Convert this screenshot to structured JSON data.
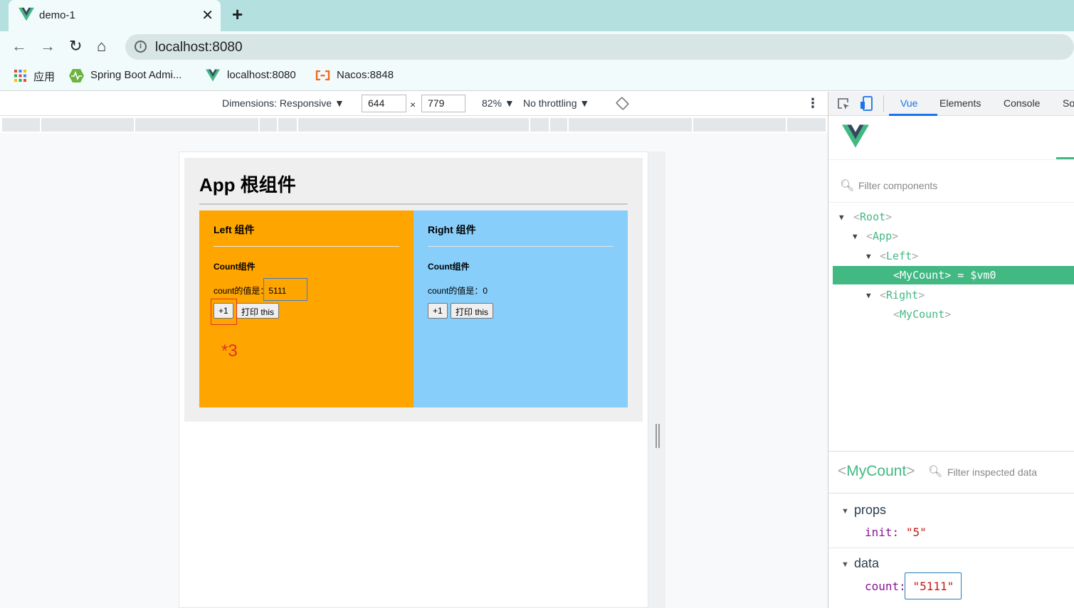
{
  "browser": {
    "tab_title": "demo-1",
    "close_glyph": "✕",
    "new_tab_glyph": "+",
    "url": "localhost:8080",
    "nav": {
      "back": "←",
      "forward": "→",
      "reload": "↻",
      "home": "⌂"
    },
    "bookmarks": [
      {
        "label": "应用",
        "icon": "apps-grid-icon"
      },
      {
        "label": "Spring Boot Admi...",
        "icon": "spring-boot-admin-icon"
      },
      {
        "label": "localhost:8080",
        "icon": "vue-logo-icon"
      },
      {
        "label": "Nacos:8848",
        "icon": "nacos-icon"
      }
    ]
  },
  "device_toolbar": {
    "dimensions_label": "Dimensions: Responsive ▼",
    "width": "644",
    "times": "×",
    "height": "779",
    "zoom": "82% ▼",
    "throttling": "No throttling ▼",
    "more": "⋮"
  },
  "page": {
    "app_title": "App 根组件",
    "left": {
      "title": "Left 组件",
      "count_title": "Count组件",
      "count_label": "count的值是：",
      "count_value": "5111",
      "plus_btn": "+1",
      "print_btn": "打印 this"
    },
    "right": {
      "title": "Right 组件",
      "count_title": "Count组件",
      "count_label": "count的值是：",
      "count_value": "0",
      "plus_btn": "+1",
      "print_btn": "打印 this"
    },
    "annotation": "*3"
  },
  "devtools": {
    "tabs": [
      "Vue",
      "Elements",
      "Console",
      "So"
    ],
    "active_tab": "Vue",
    "filter_placeholder": "Filter components",
    "tree": [
      {
        "name": "Root",
        "suffix": ""
      },
      {
        "name": "App",
        "suffix": ""
      },
      {
        "name": "Left",
        "suffix": ""
      },
      {
        "name": "MyCount",
        "suffix": " = $vm0"
      },
      {
        "name": "Right",
        "suffix": ""
      },
      {
        "name": "MyCount",
        "suffix": ""
      }
    ],
    "inspected": {
      "name": "MyCount",
      "filter_placeholder": "Filter inspected data",
      "props_label": "props",
      "props": {
        "key": "init:",
        "value": "\"5\""
      },
      "data_label": "data",
      "data": {
        "key": "count:",
        "value": "\"5111\""
      }
    }
  },
  "colors": {
    "vue_green": "#42b983",
    "left_bg": "#ffa500",
    "right_bg": "#87cefa",
    "tab_strip": "#b4e0df"
  }
}
